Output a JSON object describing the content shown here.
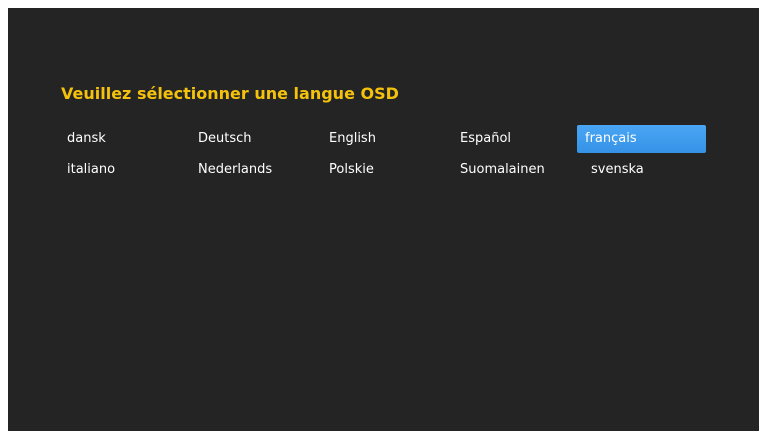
{
  "header": {
    "title": "Veuillez sélectionner une langue OSD"
  },
  "colors": {
    "background": "#242424",
    "title": "#f4c20d",
    "text": "#ffffff",
    "selected": "#3b9bee"
  },
  "languages": [
    {
      "label": "dansk",
      "selected": false
    },
    {
      "label": "Deutsch",
      "selected": false
    },
    {
      "label": "English",
      "selected": false
    },
    {
      "label": "Español",
      "selected": false
    },
    {
      "label": "français",
      "selected": true
    },
    {
      "label": "italiano",
      "selected": false
    },
    {
      "label": "Nederlands",
      "selected": false
    },
    {
      "label": "Polskie",
      "selected": false
    },
    {
      "label": "Suomalainen",
      "selected": false
    },
    {
      "label": "svenska",
      "selected": false
    }
  ]
}
